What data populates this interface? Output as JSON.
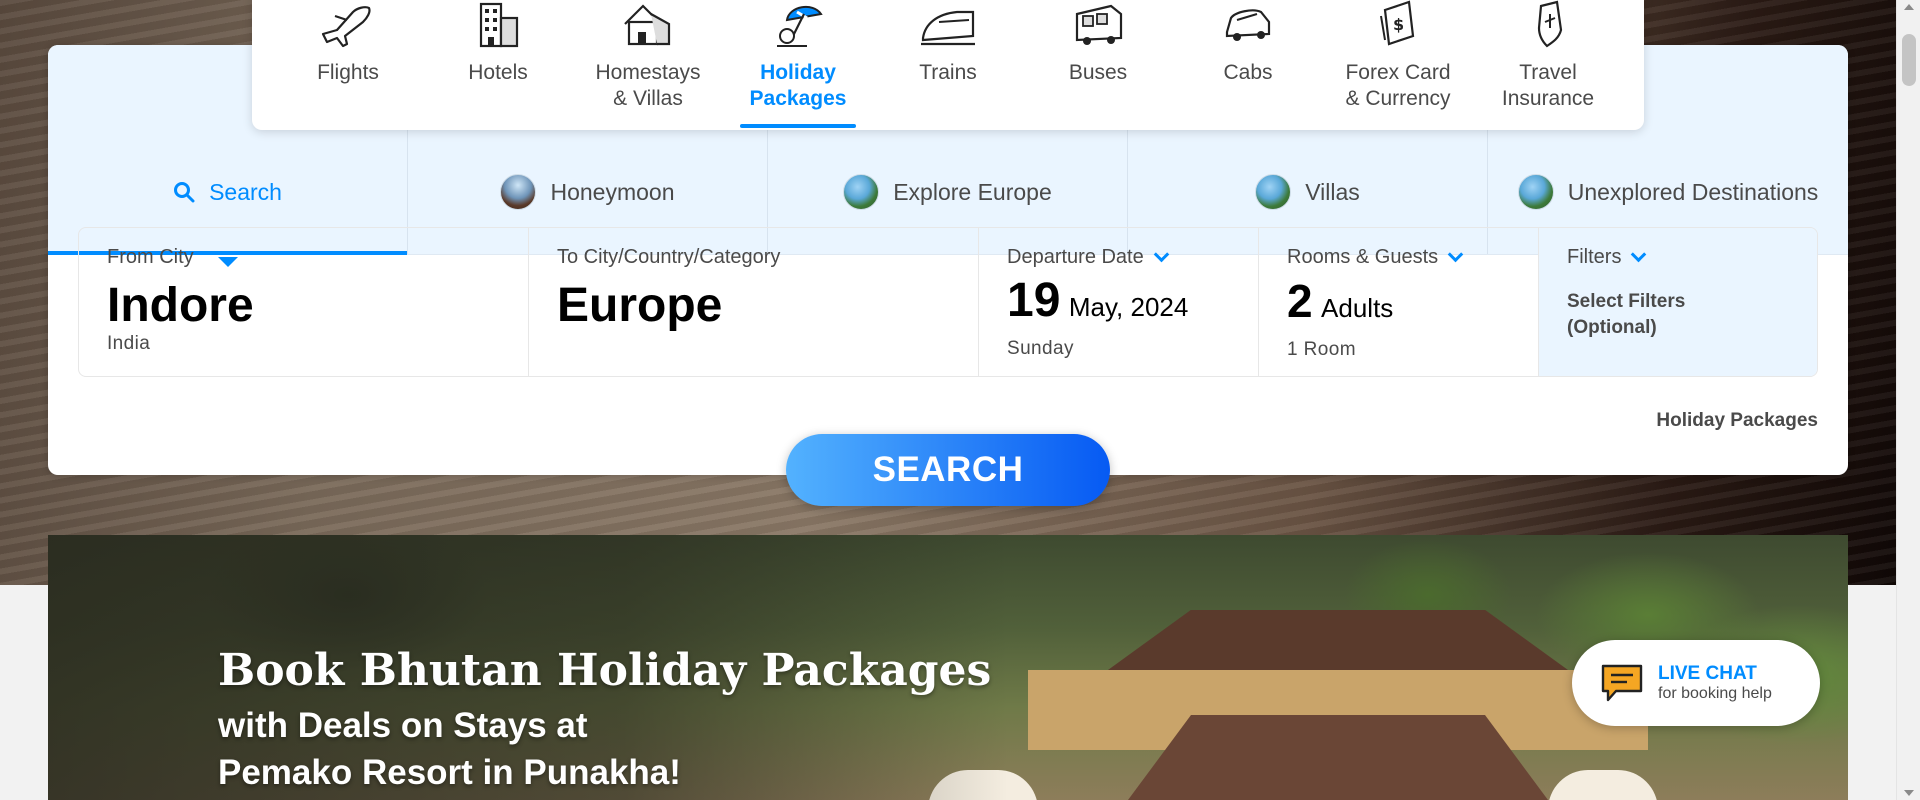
{
  "nav": {
    "items": [
      {
        "label": "Flights",
        "icon": "airplane-icon"
      },
      {
        "label": "Hotels",
        "icon": "hotel-building-icon"
      },
      {
        "label": "Homestays\n& Villas",
        "icon": "house-icon"
      },
      {
        "label": "Holiday\nPackages",
        "icon": "beach-umbrella-icon",
        "active": true
      },
      {
        "label": "Trains",
        "icon": "train-icon"
      },
      {
        "label": "Buses",
        "icon": "bus-icon"
      },
      {
        "label": "Cabs",
        "icon": "car-icon"
      },
      {
        "label": "Forex Card\n& Currency",
        "icon": "forex-card-icon"
      },
      {
        "label": "Travel\nInsurance",
        "icon": "insurance-shield-icon"
      }
    ]
  },
  "tabs": [
    {
      "label": "Search",
      "icon": "search-icon",
      "active": true
    },
    {
      "label": "Honeymoon",
      "icon": "mountain-thumbnail-icon"
    },
    {
      "label": "Explore Europe",
      "icon": "beach-thumbnail-icon"
    },
    {
      "label": "Villas",
      "icon": "beach-thumbnail-icon"
    },
    {
      "label": "Unexplored Destinations",
      "icon": "beach-thumbnail-icon"
    }
  ],
  "fields": {
    "from": {
      "label": "From City",
      "value": "Indore",
      "sub": "India"
    },
    "to": {
      "label": "To City/Country/Category",
      "value": "Europe"
    },
    "date": {
      "label": "Departure Date",
      "day": "19",
      "month_year": "May, 2024",
      "weekday": "Sunday"
    },
    "rooms": {
      "label": "Rooms & Guests",
      "count": "2",
      "guests_label": "Adults",
      "rooms": "1 Room"
    },
    "filters": {
      "label": "Filters",
      "sub": "Select Filters (Optional)"
    }
  },
  "card_tagline": "Holiday Packages",
  "search_button": "SEARCH",
  "banner": {
    "title": "Book Bhutan Holiday Packages",
    "sub1": "with Deals on Stays at",
    "sub2": "Pemako Resort in Punakha!"
  },
  "live_chat": {
    "title": "LIVE CHAT",
    "sub": "for booking help"
  },
  "colors": {
    "accent": "#008cff",
    "button_start": "#53b2fe",
    "button_end": "#065af3",
    "chat_icon": "#f5a623"
  }
}
